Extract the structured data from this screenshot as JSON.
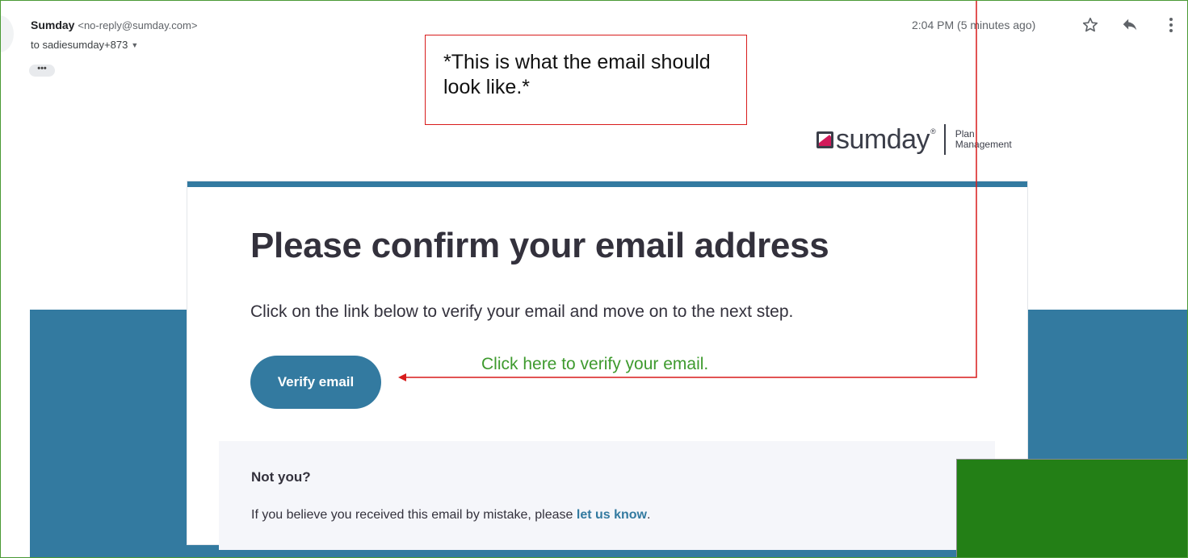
{
  "header": {
    "sender_name": "Sumday",
    "sender_email": "<no-reply@sumday.com>",
    "recipient": "to sadiesumday+873",
    "timestamp": "2:04 PM (5 minutes ago)",
    "dots": "•••",
    "icons": [
      "star-icon",
      "reply-icon",
      "more-vertical-icon"
    ]
  },
  "logo": {
    "wordmark": "sumday",
    "registered": "®",
    "sub_line1": "Plan",
    "sub_line2": "Management"
  },
  "email": {
    "title": "Please confirm your email address",
    "body": "Click on the link below to verify your email and move on to the next step.",
    "verify_button": "Verify email",
    "not_you_title": "Not you?",
    "not_you_text": "If you believe you received this email by mistake, please ",
    "not_you_link": "let us know",
    "not_you_end": "."
  },
  "annotations": {
    "callout": "*This is what the email should look like.*",
    "instruction": "Click here to verify your email."
  },
  "colors": {
    "accent_blue": "#337aa0",
    "brand_pink": "#d11a5a",
    "annotation_red": "#d81c1c",
    "annotation_green": "#3e9a2e",
    "block_green": "#237f16"
  }
}
